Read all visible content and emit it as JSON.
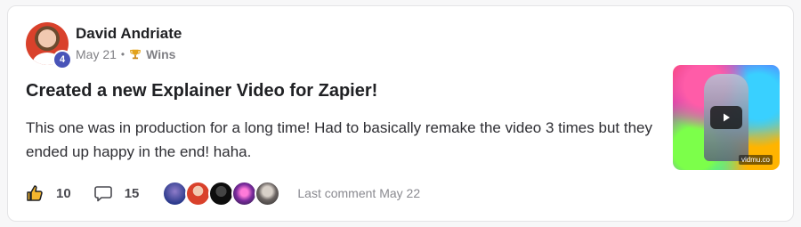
{
  "post": {
    "author": "David Andriate",
    "level": "4",
    "date": "May 21",
    "separator": "•",
    "category": "Wins",
    "title": "Created a new Explainer Video for Zapier!",
    "body": "This one was in production for a long time! Had to basically remake the video 3 times but they ended up happy in the end! haha.",
    "likes": "10",
    "comments": "15",
    "last_comment": "Last comment May 22"
  },
  "thumbnail": {
    "watermark": "vidmu.co"
  },
  "icons": {
    "like": "thumbs-up-icon",
    "comment": "comment-bubble-icon",
    "category": "trophy-icon",
    "video": "play-icon"
  },
  "colors": {
    "badge": "#4954b8",
    "text": "#202124",
    "muted": "#808085"
  }
}
